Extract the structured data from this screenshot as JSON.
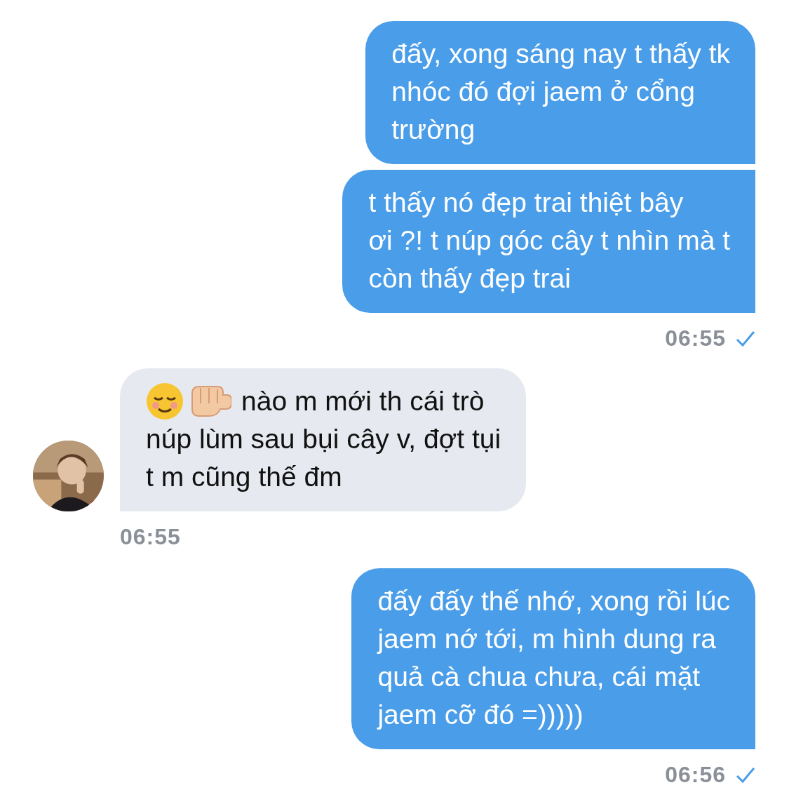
{
  "messages": [
    {
      "kind": "sent",
      "bubbles": [
        {
          "lines": [
            "đấy, xong sáng nay t thấy tk",
            "nhóc đó đợi jaem ở cổng",
            "trường"
          ]
        },
        {
          "lines": [
            "t thấy nó đẹp trai thiệt bây",
            "ơi ?! t núp góc cây t nhìn mà t",
            "còn thấy đẹp trai"
          ]
        }
      ],
      "time": "06:55",
      "read": true
    },
    {
      "kind": "received",
      "avatar": {
        "kind": "picture"
      },
      "bubbles": [
        {
          "emoji_lead": true,
          "lines": [
            "nào m mới th cái trò",
            "núp lùm sau bụi cây v, đợt tụi",
            "t m cũng thế đm"
          ]
        }
      ],
      "time": "06:55"
    },
    {
      "kind": "sent",
      "bubbles": [
        {
          "lines": [
            "đấy đấy thế nhớ, xong rồi lúc",
            "jaem nớ tới, m hình dung ra",
            "quả cà chua chưa, cái mặt",
            "jaem cỡ đó =)))))"
          ]
        }
      ],
      "time": "06:56",
      "read": true
    }
  ]
}
